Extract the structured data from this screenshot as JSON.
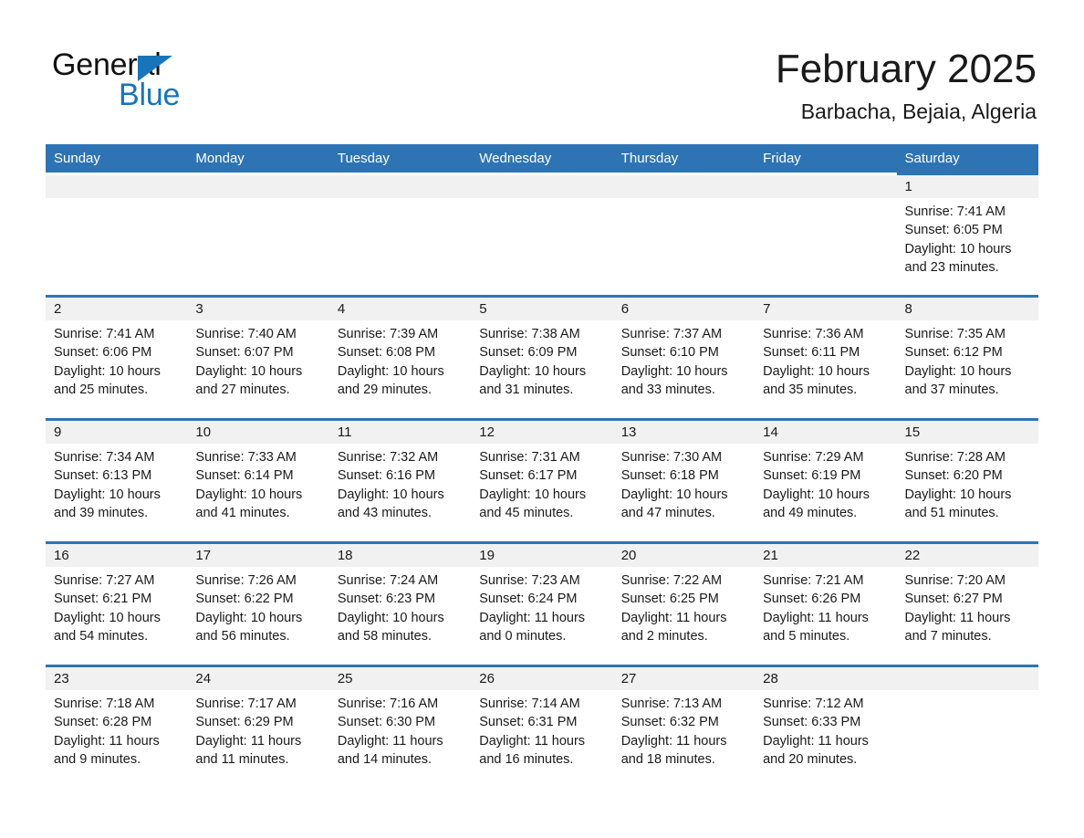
{
  "brand": {
    "name_part1": "General",
    "name_part2": "Blue",
    "accent_color": "#1874bb",
    "triangle_icon": "brand-triangle-icon"
  },
  "header": {
    "month_title": "February 2025",
    "location": "Barbacha, Bejaia, Algeria"
  },
  "calendar": {
    "header_color": "#2e74b5",
    "daynum_strip_color": "#f1f1f1",
    "weekdays": [
      "Sunday",
      "Monday",
      "Tuesday",
      "Wednesday",
      "Thursday",
      "Friday",
      "Saturday"
    ],
    "weeks": [
      [
        {
          "day": "",
          "sunrise": "",
          "sunset": "",
          "daylight1": "",
          "daylight2": ""
        },
        {
          "day": "",
          "sunrise": "",
          "sunset": "",
          "daylight1": "",
          "daylight2": ""
        },
        {
          "day": "",
          "sunrise": "",
          "sunset": "",
          "daylight1": "",
          "daylight2": ""
        },
        {
          "day": "",
          "sunrise": "",
          "sunset": "",
          "daylight1": "",
          "daylight2": ""
        },
        {
          "day": "",
          "sunrise": "",
          "sunset": "",
          "daylight1": "",
          "daylight2": ""
        },
        {
          "day": "",
          "sunrise": "",
          "sunset": "",
          "daylight1": "",
          "daylight2": ""
        },
        {
          "day": "1",
          "sunrise": "Sunrise: 7:41 AM",
          "sunset": "Sunset: 6:05 PM",
          "daylight1": "Daylight: 10 hours",
          "daylight2": "and 23 minutes."
        }
      ],
      [
        {
          "day": "2",
          "sunrise": "Sunrise: 7:41 AM",
          "sunset": "Sunset: 6:06 PM",
          "daylight1": "Daylight: 10 hours",
          "daylight2": "and 25 minutes."
        },
        {
          "day": "3",
          "sunrise": "Sunrise: 7:40 AM",
          "sunset": "Sunset: 6:07 PM",
          "daylight1": "Daylight: 10 hours",
          "daylight2": "and 27 minutes."
        },
        {
          "day": "4",
          "sunrise": "Sunrise: 7:39 AM",
          "sunset": "Sunset: 6:08 PM",
          "daylight1": "Daylight: 10 hours",
          "daylight2": "and 29 minutes."
        },
        {
          "day": "5",
          "sunrise": "Sunrise: 7:38 AM",
          "sunset": "Sunset: 6:09 PM",
          "daylight1": "Daylight: 10 hours",
          "daylight2": "and 31 minutes."
        },
        {
          "day": "6",
          "sunrise": "Sunrise: 7:37 AM",
          "sunset": "Sunset: 6:10 PM",
          "daylight1": "Daylight: 10 hours",
          "daylight2": "and 33 minutes."
        },
        {
          "day": "7",
          "sunrise": "Sunrise: 7:36 AM",
          "sunset": "Sunset: 6:11 PM",
          "daylight1": "Daylight: 10 hours",
          "daylight2": "and 35 minutes."
        },
        {
          "day": "8",
          "sunrise": "Sunrise: 7:35 AM",
          "sunset": "Sunset: 6:12 PM",
          "daylight1": "Daylight: 10 hours",
          "daylight2": "and 37 minutes."
        }
      ],
      [
        {
          "day": "9",
          "sunrise": "Sunrise: 7:34 AM",
          "sunset": "Sunset: 6:13 PM",
          "daylight1": "Daylight: 10 hours",
          "daylight2": "and 39 minutes."
        },
        {
          "day": "10",
          "sunrise": "Sunrise: 7:33 AM",
          "sunset": "Sunset: 6:14 PM",
          "daylight1": "Daylight: 10 hours",
          "daylight2": "and 41 minutes."
        },
        {
          "day": "11",
          "sunrise": "Sunrise: 7:32 AM",
          "sunset": "Sunset: 6:16 PM",
          "daylight1": "Daylight: 10 hours",
          "daylight2": "and 43 minutes."
        },
        {
          "day": "12",
          "sunrise": "Sunrise: 7:31 AM",
          "sunset": "Sunset: 6:17 PM",
          "daylight1": "Daylight: 10 hours",
          "daylight2": "and 45 minutes."
        },
        {
          "day": "13",
          "sunrise": "Sunrise: 7:30 AM",
          "sunset": "Sunset: 6:18 PM",
          "daylight1": "Daylight: 10 hours",
          "daylight2": "and 47 minutes."
        },
        {
          "day": "14",
          "sunrise": "Sunrise: 7:29 AM",
          "sunset": "Sunset: 6:19 PM",
          "daylight1": "Daylight: 10 hours",
          "daylight2": "and 49 minutes."
        },
        {
          "day": "15",
          "sunrise": "Sunrise: 7:28 AM",
          "sunset": "Sunset: 6:20 PM",
          "daylight1": "Daylight: 10 hours",
          "daylight2": "and 51 minutes."
        }
      ],
      [
        {
          "day": "16",
          "sunrise": "Sunrise: 7:27 AM",
          "sunset": "Sunset: 6:21 PM",
          "daylight1": "Daylight: 10 hours",
          "daylight2": "and 54 minutes."
        },
        {
          "day": "17",
          "sunrise": "Sunrise: 7:26 AM",
          "sunset": "Sunset: 6:22 PM",
          "daylight1": "Daylight: 10 hours",
          "daylight2": "and 56 minutes."
        },
        {
          "day": "18",
          "sunrise": "Sunrise: 7:24 AM",
          "sunset": "Sunset: 6:23 PM",
          "daylight1": "Daylight: 10 hours",
          "daylight2": "and 58 minutes."
        },
        {
          "day": "19",
          "sunrise": "Sunrise: 7:23 AM",
          "sunset": "Sunset: 6:24 PM",
          "daylight1": "Daylight: 11 hours",
          "daylight2": "and 0 minutes."
        },
        {
          "day": "20",
          "sunrise": "Sunrise: 7:22 AM",
          "sunset": "Sunset: 6:25 PM",
          "daylight1": "Daylight: 11 hours",
          "daylight2": "and 2 minutes."
        },
        {
          "day": "21",
          "sunrise": "Sunrise: 7:21 AM",
          "sunset": "Sunset: 6:26 PM",
          "daylight1": "Daylight: 11 hours",
          "daylight2": "and 5 minutes."
        },
        {
          "day": "22",
          "sunrise": "Sunrise: 7:20 AM",
          "sunset": "Sunset: 6:27 PM",
          "daylight1": "Daylight: 11 hours",
          "daylight2": "and 7 minutes."
        }
      ],
      [
        {
          "day": "23",
          "sunrise": "Sunrise: 7:18 AM",
          "sunset": "Sunset: 6:28 PM",
          "daylight1": "Daylight: 11 hours",
          "daylight2": "and 9 minutes."
        },
        {
          "day": "24",
          "sunrise": "Sunrise: 7:17 AM",
          "sunset": "Sunset: 6:29 PM",
          "daylight1": "Daylight: 11 hours",
          "daylight2": "and 11 minutes."
        },
        {
          "day": "25",
          "sunrise": "Sunrise: 7:16 AM",
          "sunset": "Sunset: 6:30 PM",
          "daylight1": "Daylight: 11 hours",
          "daylight2": "and 14 minutes."
        },
        {
          "day": "26",
          "sunrise": "Sunrise: 7:14 AM",
          "sunset": "Sunset: 6:31 PM",
          "daylight1": "Daylight: 11 hours",
          "daylight2": "and 16 minutes."
        },
        {
          "day": "27",
          "sunrise": "Sunrise: 7:13 AM",
          "sunset": "Sunset: 6:32 PM",
          "daylight1": "Daylight: 11 hours",
          "daylight2": "and 18 minutes."
        },
        {
          "day": "28",
          "sunrise": "Sunrise: 7:12 AM",
          "sunset": "Sunset: 6:33 PM",
          "daylight1": "Daylight: 11 hours",
          "daylight2": "and 20 minutes."
        },
        {
          "day": "",
          "sunrise": "",
          "sunset": "",
          "daylight1": "",
          "daylight2": ""
        }
      ]
    ]
  }
}
